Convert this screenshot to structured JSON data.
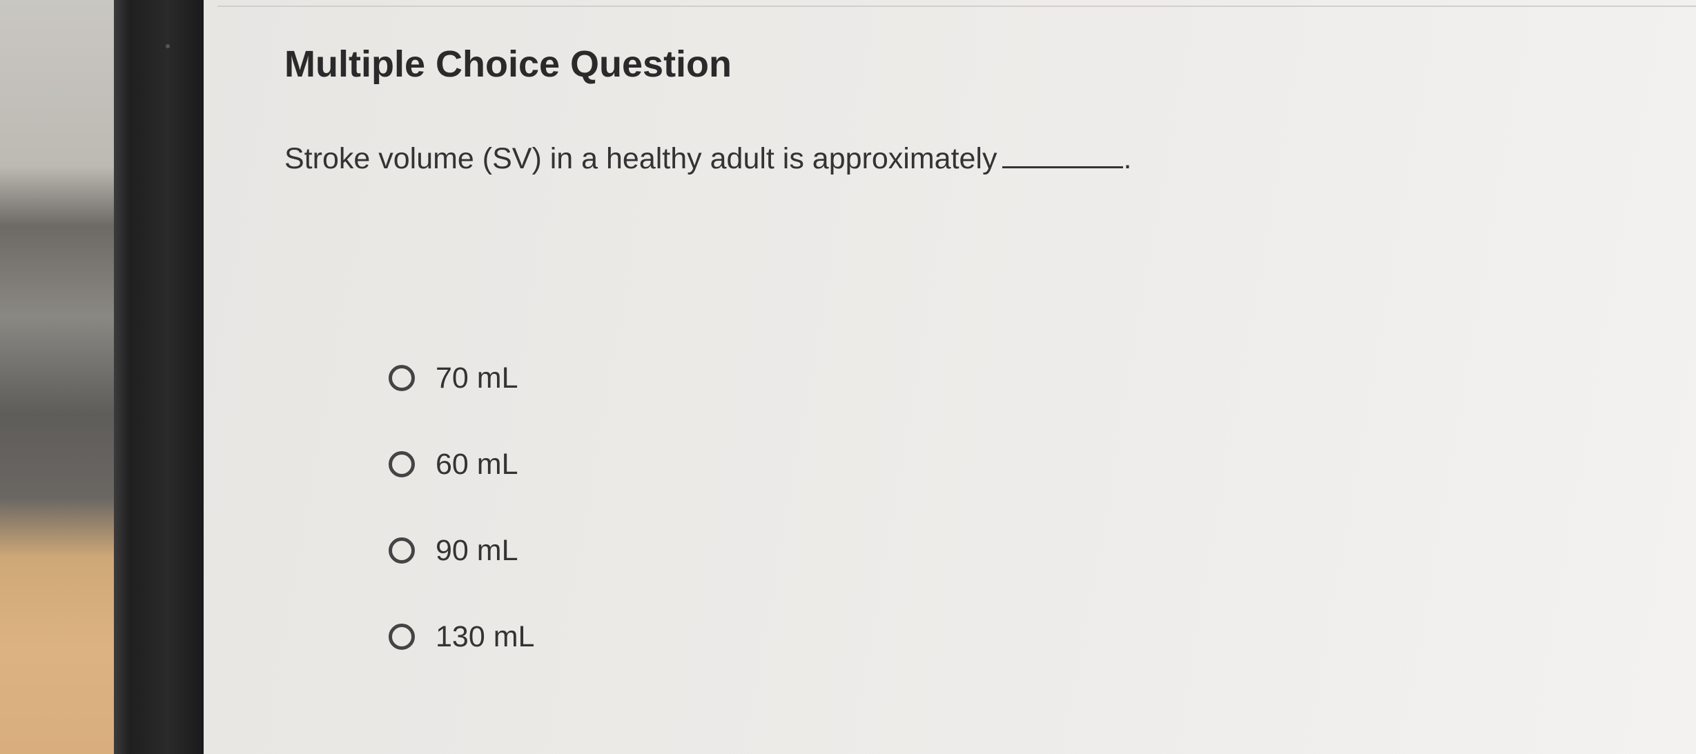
{
  "question": {
    "title": "Multiple Choice Question",
    "prompt": "Stroke volume (SV) in a healthy adult is approximately",
    "blank_suffix": "."
  },
  "options": [
    {
      "label": "70 mL"
    },
    {
      "label": "60 mL"
    },
    {
      "label": "90 mL"
    },
    {
      "label": "130 mL"
    }
  ],
  "colors": {
    "text": "#333333",
    "title": "#2a2a2a",
    "screen_background": "#eceae7",
    "bezel": "#1f1f20"
  }
}
